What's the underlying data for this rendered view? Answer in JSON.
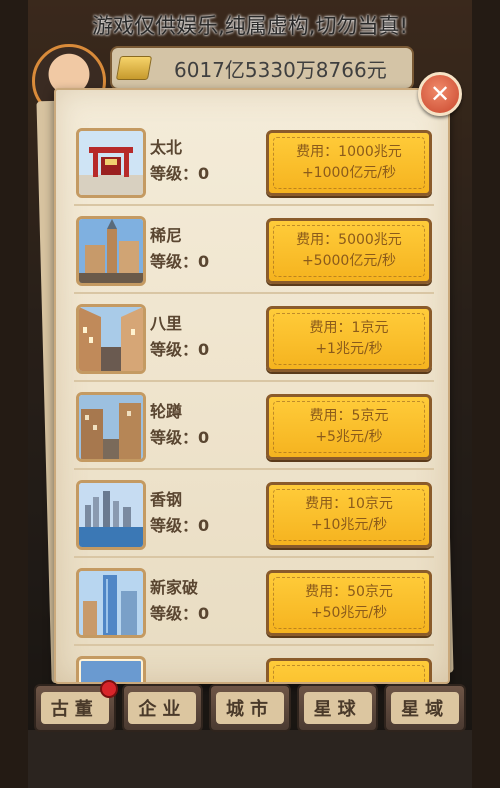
{
  "disclaimer": "游戏仅供娱乐,纯属虚构,切勿当真!",
  "player": {
    "money": "6017亿5330万8766元"
  },
  "icons": {
    "money": "gold-bar-icon",
    "close": "close-icon"
  },
  "cities": [
    {
      "name": "太北",
      "level": "等级：0",
      "cost": "费用：1000兆元",
      "income": "+1000亿元/秒"
    },
    {
      "name": "稀尼",
      "level": "等级：0",
      "cost": "费用：5000兆元",
      "income": "+5000亿元/秒"
    },
    {
      "name": "八里",
      "level": "等级：0",
      "cost": "费用：1京元",
      "income": "+1兆元/秒"
    },
    {
      "name": "轮蹲",
      "level": "等级：0",
      "cost": "费用：5京元",
      "income": "+5兆元/秒"
    },
    {
      "name": "香钢",
      "level": "等级：0",
      "cost": "费用：10京元",
      "income": "+10兆元/秒"
    },
    {
      "name": "新家破",
      "level": "等级：0",
      "cost": "费用：50京元",
      "income": "+50兆元/秒"
    }
  ],
  "tabs": [
    {
      "label": "古董",
      "badge": true
    },
    {
      "label": "企业",
      "badge": false
    },
    {
      "label": "城市",
      "badge": false
    },
    {
      "label": "星球",
      "badge": false
    },
    {
      "label": "星域",
      "badge": false
    }
  ],
  "colors": {
    "button": "#f5b31f",
    "panel": "#efe4cd",
    "badge": "#d8252a"
  }
}
